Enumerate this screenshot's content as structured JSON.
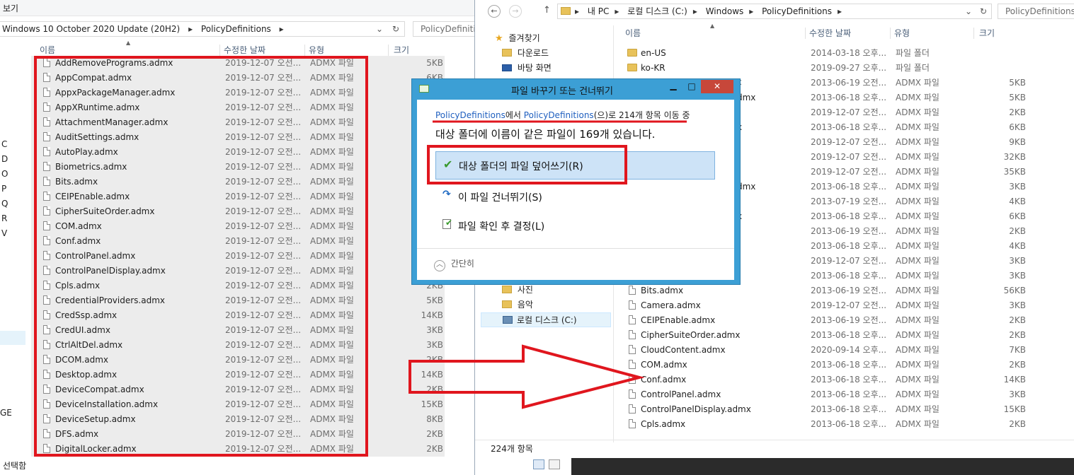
{
  "left_window": {
    "menu_label": "보기",
    "address_path": [
      "Windows 10 October 2020 Update (20H2)",
      "PolicyDefinitions"
    ],
    "search_placeholder": "PolicyDefinitio",
    "columns": {
      "name": "이름",
      "date": "수정한 날짜",
      "type": "유형",
      "size": "크기"
    },
    "nav_letters": [
      "C",
      "D",
      "O",
      "P",
      "Q",
      "R",
      "V"
    ],
    "nav_partial": "GE",
    "status": "선택함",
    "files": [
      {
        "name": "AddRemovePrograms.admx",
        "date": "2019-12-07 오선...",
        "type": "ADMX 파일",
        "size": "5KB"
      },
      {
        "name": "AppCompat.admx",
        "date": "2019-12-07 오전...",
        "type": "ADMX 파일",
        "size": "6KB"
      },
      {
        "name": "AppxPackageManager.admx",
        "date": "2019-12-07 오전...",
        "type": "ADMX 파일",
        "size": ""
      },
      {
        "name": "AppXRuntime.admx",
        "date": "2019-12-07 오전...",
        "type": "ADMX 파일",
        "size": ""
      },
      {
        "name": "AttachmentManager.admx",
        "date": "2019-12-07 오전...",
        "type": "ADMX 파일",
        "size": ""
      },
      {
        "name": "AuditSettings.admx",
        "date": "2019-12-07 오전...",
        "type": "ADMX 파일",
        "size": ""
      },
      {
        "name": "AutoPlay.admx",
        "date": "2019-12-07 오전...",
        "type": "ADMX 파일",
        "size": ""
      },
      {
        "name": "Biometrics.admx",
        "date": "2019-12-07 오전...",
        "type": "ADMX 파일",
        "size": ""
      },
      {
        "name": "Bits.admx",
        "date": "2019-12-07 오전...",
        "type": "ADMX 파일",
        "size": ""
      },
      {
        "name": "CEIPEnable.admx",
        "date": "2019-12-07 오전...",
        "type": "ADMX 파일",
        "size": ""
      },
      {
        "name": "CipherSuiteOrder.admx",
        "date": "2019-12-07 오전...",
        "type": "ADMX 파일",
        "size": ""
      },
      {
        "name": "COM.admx",
        "date": "2019-12-07 오전...",
        "type": "ADMX 파일",
        "size": ""
      },
      {
        "name": "Conf.admx",
        "date": "2019-12-07 오전...",
        "type": "ADMX 파일",
        "size": ""
      },
      {
        "name": "ControlPanel.admx",
        "date": "2019-12-07 오전...",
        "type": "ADMX 파일",
        "size": ""
      },
      {
        "name": "ControlPanelDisplay.admx",
        "date": "2019-12-07 오전...",
        "type": "ADMX 파일",
        "size": ""
      },
      {
        "name": "Cpls.admx",
        "date": "2019-12-07 오전...",
        "type": "ADMX 파일",
        "size": "2KB"
      },
      {
        "name": "CredentialProviders.admx",
        "date": "2019-12-07 오전...",
        "type": "ADMX 파일",
        "size": "5KB"
      },
      {
        "name": "CredSsp.admx",
        "date": "2019-12-07 오전...",
        "type": "ADMX 파일",
        "size": "14KB"
      },
      {
        "name": "CredUI.admx",
        "date": "2019-12-07 오전...",
        "type": "ADMX 파일",
        "size": "3KB"
      },
      {
        "name": "CtrlAltDel.admx",
        "date": "2019-12-07 오전...",
        "type": "ADMX 파일",
        "size": "3KB"
      },
      {
        "name": "DCOM.admx",
        "date": "2019-12-07 오전...",
        "type": "ADMX 파일",
        "size": "2KB"
      },
      {
        "name": "Desktop.admx",
        "date": "2019-12-07 오전...",
        "type": "ADMX 파일",
        "size": "14KB"
      },
      {
        "name": "DeviceCompat.admx",
        "date": "2019-12-07 오전...",
        "type": "ADMX 파일",
        "size": "2KB"
      },
      {
        "name": "DeviceInstallation.admx",
        "date": "2019-12-07 오전...",
        "type": "ADMX 파일",
        "size": "15KB"
      },
      {
        "name": "DeviceSetup.admx",
        "date": "2019-12-07 오전...",
        "type": "ADMX 파일",
        "size": "8KB"
      },
      {
        "name": "DFS.admx",
        "date": "2019-12-07 오전...",
        "type": "ADMX 파일",
        "size": "2KB"
      },
      {
        "name": "DigitalLocker.admx",
        "date": "2019-12-07 오전...",
        "type": "ADMX 파일",
        "size": "2KB"
      }
    ]
  },
  "right_window": {
    "address_path": [
      "내 PC",
      "로컬 디스크 (C:)",
      "Windows",
      "PolicyDefinitions"
    ],
    "search_placeholder": "PolicyDefinitions 검",
    "columns": {
      "name": "이름",
      "date": "수정한 날짜",
      "type": "유형",
      "size": "크기"
    },
    "nav_favorites": "즐겨찾기",
    "nav_items_top": [
      "다운로드",
      "바탕 화면"
    ],
    "nav_items_bottom": [
      "사진",
      "음악",
      "로컬 디스크 (C:)"
    ],
    "status": "224개 항목",
    "files": [
      {
        "name": "en-US",
        "date": "2014-03-18 오후...",
        "type": "파일 폴더",
        "size": "",
        "folder": true
      },
      {
        "name": "ko-KR",
        "date": "2019-09-27 오후...",
        "type": "파일 폴더",
        "size": "",
        "folder": true
      },
      {
        "name": "",
        "date": "2013-06-19 오전...",
        "type": "ADMX 파일",
        "size": "5KB"
      },
      {
        "name": "",
        "date": "2013-06-18 오후...",
        "type": "ADMX 파일",
        "size": "5KB"
      },
      {
        "name": "",
        "date": "2019-12-07 오전...",
        "type": "ADMX 파일",
        "size": "2KB"
      },
      {
        "name": "",
        "date": "2013-06-18 오후...",
        "type": "ADMX 파일",
        "size": "6KB"
      },
      {
        "name": "",
        "date": "2019-12-07 오전...",
        "type": "ADMX 파일",
        "size": "9KB"
      },
      {
        "name": "",
        "date": "2019-12-07 오전...",
        "type": "ADMX 파일",
        "size": "32KB"
      },
      {
        "name": "",
        "date": "2019-12-07 오전...",
        "type": "ADMX 파일",
        "size": "35KB"
      },
      {
        "name": "",
        "date": "2013-06-18 오후...",
        "type": "ADMX 파일",
        "size": "3KB"
      },
      {
        "name": "",
        "date": "2013-07-19 오전...",
        "type": "ADMX 파일",
        "size": "4KB"
      },
      {
        "name": "",
        "date": "2013-06-18 오후...",
        "type": "ADMX 파일",
        "size": "6KB"
      },
      {
        "name": "",
        "date": "2013-06-19 오전...",
        "type": "ADMX 파일",
        "size": "2KB"
      },
      {
        "name": "",
        "date": "2013-06-18 오후...",
        "type": "ADMX 파일",
        "size": "4KB"
      },
      {
        "name": "",
        "date": "2019-12-07 오전...",
        "type": "ADMX 파일",
        "size": "3KB"
      },
      {
        "name": "",
        "date": "2013-06-18 오후...",
        "type": "ADMX 파일",
        "size": "3KB"
      },
      {
        "name": "Bits.admx",
        "date": "2013-06-19 오전...",
        "type": "ADMX 파일",
        "size": "56KB"
      },
      {
        "name": "Camera.admx",
        "date": "2019-12-07 오전...",
        "type": "ADMX 파일",
        "size": "3KB"
      },
      {
        "name": "CEIPEnable.admx",
        "date": "2013-06-19 오전...",
        "type": "ADMX 파일",
        "size": "2KB"
      },
      {
        "name": "CipherSuiteOrder.admx",
        "date": "2013-06-18 오후...",
        "type": "ADMX 파일",
        "size": "2KB"
      },
      {
        "name": "CloudContent.admx",
        "date": "2020-09-14 오후...",
        "type": "ADMX 파일",
        "size": "7KB"
      },
      {
        "name": "COM.admx",
        "date": "2013-06-18 오후...",
        "type": "ADMX 파일",
        "size": "2KB"
      },
      {
        "name": "Conf.admx",
        "date": "2013-06-18 오후...",
        "type": "ADMX 파일",
        "size": "14KB"
      },
      {
        "name": "ControlPanel.admx",
        "date": "2013-06-18 오후...",
        "type": "ADMX 파일",
        "size": "3KB"
      },
      {
        "name": "ControlPanelDisplay.admx",
        "date": "2013-06-18 오후...",
        "type": "ADMX 파일",
        "size": "15KB"
      },
      {
        "name": "Cpls.admx",
        "date": "2013-06-18 오후...",
        "type": "ADMX 파일",
        "size": "2KB"
      }
    ],
    "partial_names": [
      "c",
      "dmx",
      "x",
      "x",
      "dmx"
    ]
  },
  "dialog": {
    "title": "파일 바꾸기 또는 건너뛰기",
    "source": "PolicyDefinitions",
    "from_suffix": "에서 ",
    "dest": "PolicyDefinitions",
    "count_text": "(으)로 214개 항목 이동 중",
    "conflict_text": "대상 폴더에 이름이 같은 파일이 169개 있습니다.",
    "option_replace": "대상 폴더의 파일 덮어쓰기(R)",
    "option_skip": "이 파일 건너뛰기(S)",
    "option_decide": "파일 확인 후 결정(L)",
    "fewer_details": "간단히",
    "accent": "#3c9fd5"
  },
  "annotation_color": "#e0161e"
}
